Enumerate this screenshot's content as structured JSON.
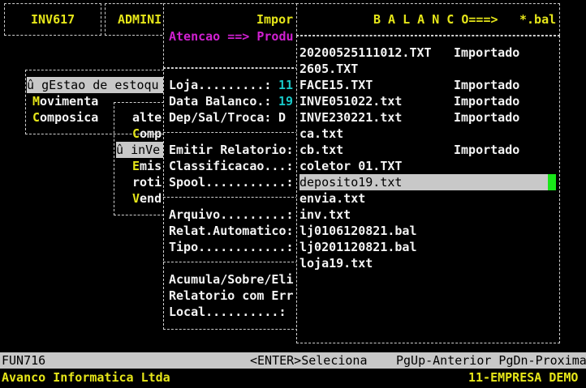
{
  "top": {
    "code": "INV617",
    "user": "ADMINI",
    "title_import": "Impor",
    "balanco_title": "B A L A N C O===>",
    "ext": "*.bal",
    "notice": "Atencao ==> Produ"
  },
  "main_menu": {
    "items": [
      {
        "prefix": "û ",
        "hot": "g",
        "rest": "Estao de estoqu"
      },
      {
        "prefix": "",
        "hot": "M",
        "rest": "ovimenta"
      },
      {
        "prefix": "",
        "hot": "C",
        "rest": "omposica"
      }
    ]
  },
  "sub_menu": {
    "items": [
      {
        "prefix": "",
        "hot": "",
        "rest": "alte"
      },
      {
        "prefix": "",
        "hot": "C",
        "rest": "omp"
      },
      {
        "prefix": "û ",
        "hot": "",
        "rest": "inVe"
      },
      {
        "prefix": "",
        "hot": "E",
        "rest": "mis"
      },
      {
        "prefix": "",
        "hot": "",
        "rest": "roti"
      },
      {
        "prefix": "",
        "hot": "V",
        "rest": "end"
      }
    ]
  },
  "form": {
    "loja_label": "Loja.........:",
    "loja_value": "11",
    "data_label": "Data Balanco.:",
    "data_value": "19",
    "dep_label": "Dep/Sal/Troca:",
    "dep_value": "D",
    "emitir_label": "Emitir Relatorio:",
    "classif_label": "Classificacao...:",
    "spool_label": "Spool...........:",
    "arquivo_label": "Arquivo.........:",
    "relat_label": "Relat.Automatico:",
    "tipo_label": "Tipo............:",
    "acumula_label": "Acumula/Sobre/Eli",
    "relerr_label": "Relatorio com Err",
    "local_label": "Local..........:"
  },
  "files": [
    {
      "name": "20200525111012.TXT",
      "status": "Importado"
    },
    {
      "name": "2605.TXT",
      "status": ""
    },
    {
      "name": "FACE15.TXT",
      "status": "Importado"
    },
    {
      "name": "INVE051022.txt",
      "status": "Importado"
    },
    {
      "name": "INVE230221.txt",
      "status": "Importado"
    },
    {
      "name": "ca.txt",
      "status": ""
    },
    {
      "name": "cb.txt",
      "status": "Importado"
    },
    {
      "name": "coletor 01.TXT",
      "status": ""
    },
    {
      "name": "deposito19.txt",
      "status": ""
    },
    {
      "name": "envia.txt",
      "status": ""
    },
    {
      "name": "inv.txt",
      "status": ""
    },
    {
      "name": "lj0106120821.bal",
      "status": ""
    },
    {
      "name": "lj0201120821.bal",
      "status": ""
    },
    {
      "name": "loja19.txt",
      "status": ""
    }
  ],
  "status_bar": {
    "func": "FUN716",
    "enter": "<ENTER>Seleciona",
    "pg": "PgUp-Anterior PgDn-Proxima"
  },
  "footer": {
    "company_left": "Avanco Informatica Ltda",
    "company_right": "11-EMPRESA DEMO"
  },
  "colors": {
    "statusbar_bg": "#c8c8c8",
    "selection_bg": "#c8c8c8",
    "scroll_marker": "#19e619",
    "hotkey": "#e6e619"
  }
}
